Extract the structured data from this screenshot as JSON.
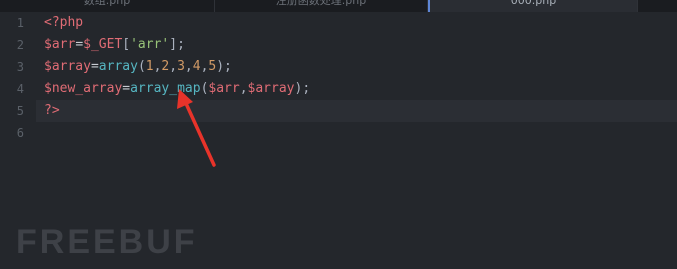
{
  "tabs": [
    {
      "label": "数组.php"
    },
    {
      "label": "注册函数处理.php"
    },
    {
      "label": "000.php"
    },
    {
      "label": ""
    }
  ],
  "lines": [
    {
      "num": "1"
    },
    {
      "num": "2"
    },
    {
      "num": "3"
    },
    {
      "num": "4"
    },
    {
      "num": "5"
    },
    {
      "num": "6"
    }
  ],
  "code": {
    "l1": {
      "open_tag": "<?php"
    },
    "l2": {
      "var": "$arr",
      "eq": "=",
      "get": "$_GET",
      "lb": "[",
      "str": "'arr'",
      "rb": "];"
    },
    "l3": {
      "var": "$array",
      "eq": "=",
      "func": "array",
      "lp": "(",
      "n1": "1",
      "c1": ",",
      "n2": "2",
      "c2": ",",
      "n3": "3",
      "c3": ",",
      "n4": "4",
      "c4": ",",
      "n5": "5",
      "rp": ");"
    },
    "l4": {
      "var": "$new_array",
      "eq": "=",
      "func": "array_map",
      "lp": "(",
      "a1": "$arr",
      "c1": ",",
      "a2": "$array",
      "rp": ");"
    },
    "l5": {
      "close_tag": "?>"
    }
  },
  "watermark": {
    "text": "FREEBUF"
  },
  "colors": {
    "arrow": "#e8332a",
    "active_tab_accent": "#5e86d6"
  }
}
